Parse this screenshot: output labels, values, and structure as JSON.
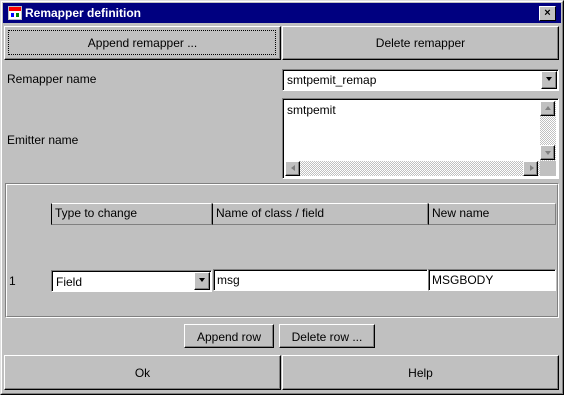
{
  "window": {
    "title": "Remapper definition",
    "close_glyph": "×",
    "icon": "app-icon"
  },
  "toolbar": {
    "append_label": "Append remapper ...",
    "delete_label": "Delete remapper"
  },
  "form": {
    "remapper_name_label": "Remapper name",
    "remapper_name_value": "smtpemit_remap",
    "emitter_name_label": "Emitter name",
    "emitter_name_value": "smtpemit"
  },
  "table": {
    "columns": [
      "Type to change",
      "Name of class / field",
      "New name"
    ],
    "rows": [
      {
        "index": "1",
        "type": "Field",
        "name": "msg",
        "new_name": "MSGBODY"
      }
    ]
  },
  "row_actions": {
    "append_row": "Append row",
    "delete_row": "Delete row ..."
  },
  "footer": {
    "ok": "Ok",
    "help": "Help"
  },
  "colors": {
    "titlebar": "#000080",
    "face": "#c0c0c0"
  }
}
